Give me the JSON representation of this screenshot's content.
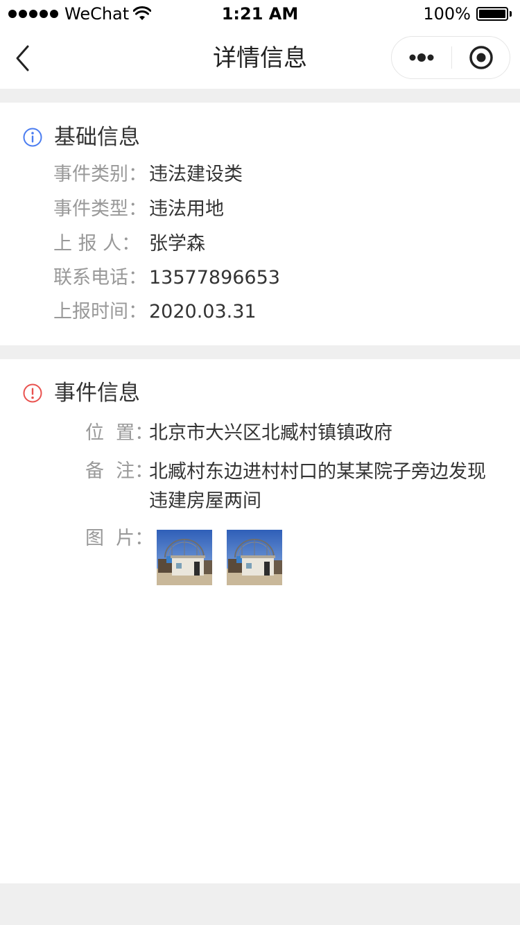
{
  "status_bar": {
    "carrier": "WeChat",
    "time": "1:21 AM",
    "battery": "100%"
  },
  "nav": {
    "title": "详情信息"
  },
  "basic_info": {
    "title": "基础信息",
    "icon_color": "#4a7cf0",
    "fields": [
      {
        "label": "事件类别：",
        "value": "违法建设类"
      },
      {
        "label": "事件类型：",
        "value": "违法用地"
      },
      {
        "label": "上 报 人：",
        "value": "张学森"
      },
      {
        "label": "联系电话：",
        "value": "13577896653"
      },
      {
        "label": "上报时间：",
        "value": "2020.03.31"
      }
    ]
  },
  "event_info": {
    "title": "事件信息",
    "icon_color": "#e9514e",
    "location_label": "位  置：",
    "location_value": "北京市大兴区北臧村镇镇政府",
    "note_label": "备  注：",
    "note_value": "北臧村东边进村村口的某某院子旁边发现违建房屋两间",
    "images_label": "图  片：",
    "images": [
      "building-photo",
      "building-photo"
    ]
  }
}
